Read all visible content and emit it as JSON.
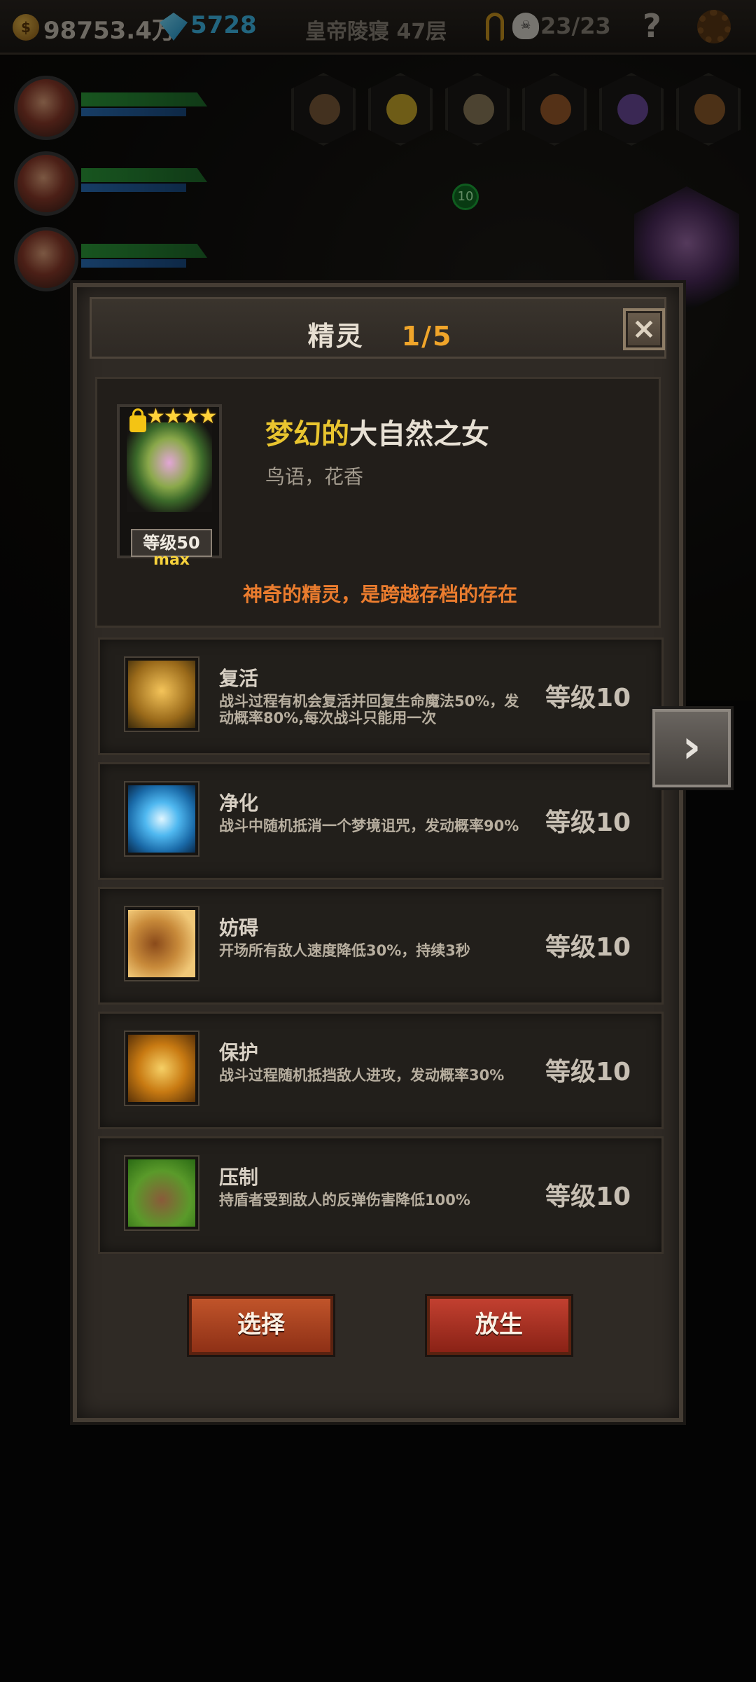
{
  "topbar": {
    "gold": "98753.4万",
    "gems": "5728",
    "location": "皇帝陵寝 47层",
    "kills": "23/23",
    "help_label": "?"
  },
  "scene": {
    "badge_count": "10"
  },
  "modal": {
    "title": "精灵",
    "page_indicator": "1/5",
    "close_label": "×"
  },
  "pet": {
    "name_highlight": "梦幻的",
    "name_rest": "大自然之女",
    "subtitle": "鸟语，花香",
    "stars": "★★★★",
    "star_count": 4,
    "level": "等级50",
    "max_label": "max",
    "description": "神奇的精灵，是跨越存档的存在"
  },
  "skills": [
    {
      "name": "复活",
      "desc": "战斗过程有机会复活并回复生命魔法50%，发动概率80%,每次战斗只能用一次",
      "level": "等级10",
      "icon": "revive-icon"
    },
    {
      "name": "净化",
      "desc": "战斗中随机抵消一个梦境诅咒，发动概率90%",
      "level": "等级10",
      "icon": "purify-icon"
    },
    {
      "name": "妨碍",
      "desc": "开场所有敌人速度降低30%，持续3秒",
      "level": "等级10",
      "icon": "hinder-icon"
    },
    {
      "name": "保护",
      "desc": "战斗过程随机抵挡敌人进攻，发动概率30%",
      "level": "等级10",
      "icon": "protect-icon"
    },
    {
      "name": "压制",
      "desc": "持盾者受到敌人的反弹伤害降低100%",
      "level": "等级10",
      "icon": "suppress-icon"
    }
  ],
  "actions": {
    "select_label": "选择",
    "release_label": "放生"
  },
  "colors": {
    "accent_gold": "#e9c52f",
    "page_orange": "#f0a52a",
    "desc_orange": "#ea7c2e",
    "button_red": "#c0542a"
  }
}
